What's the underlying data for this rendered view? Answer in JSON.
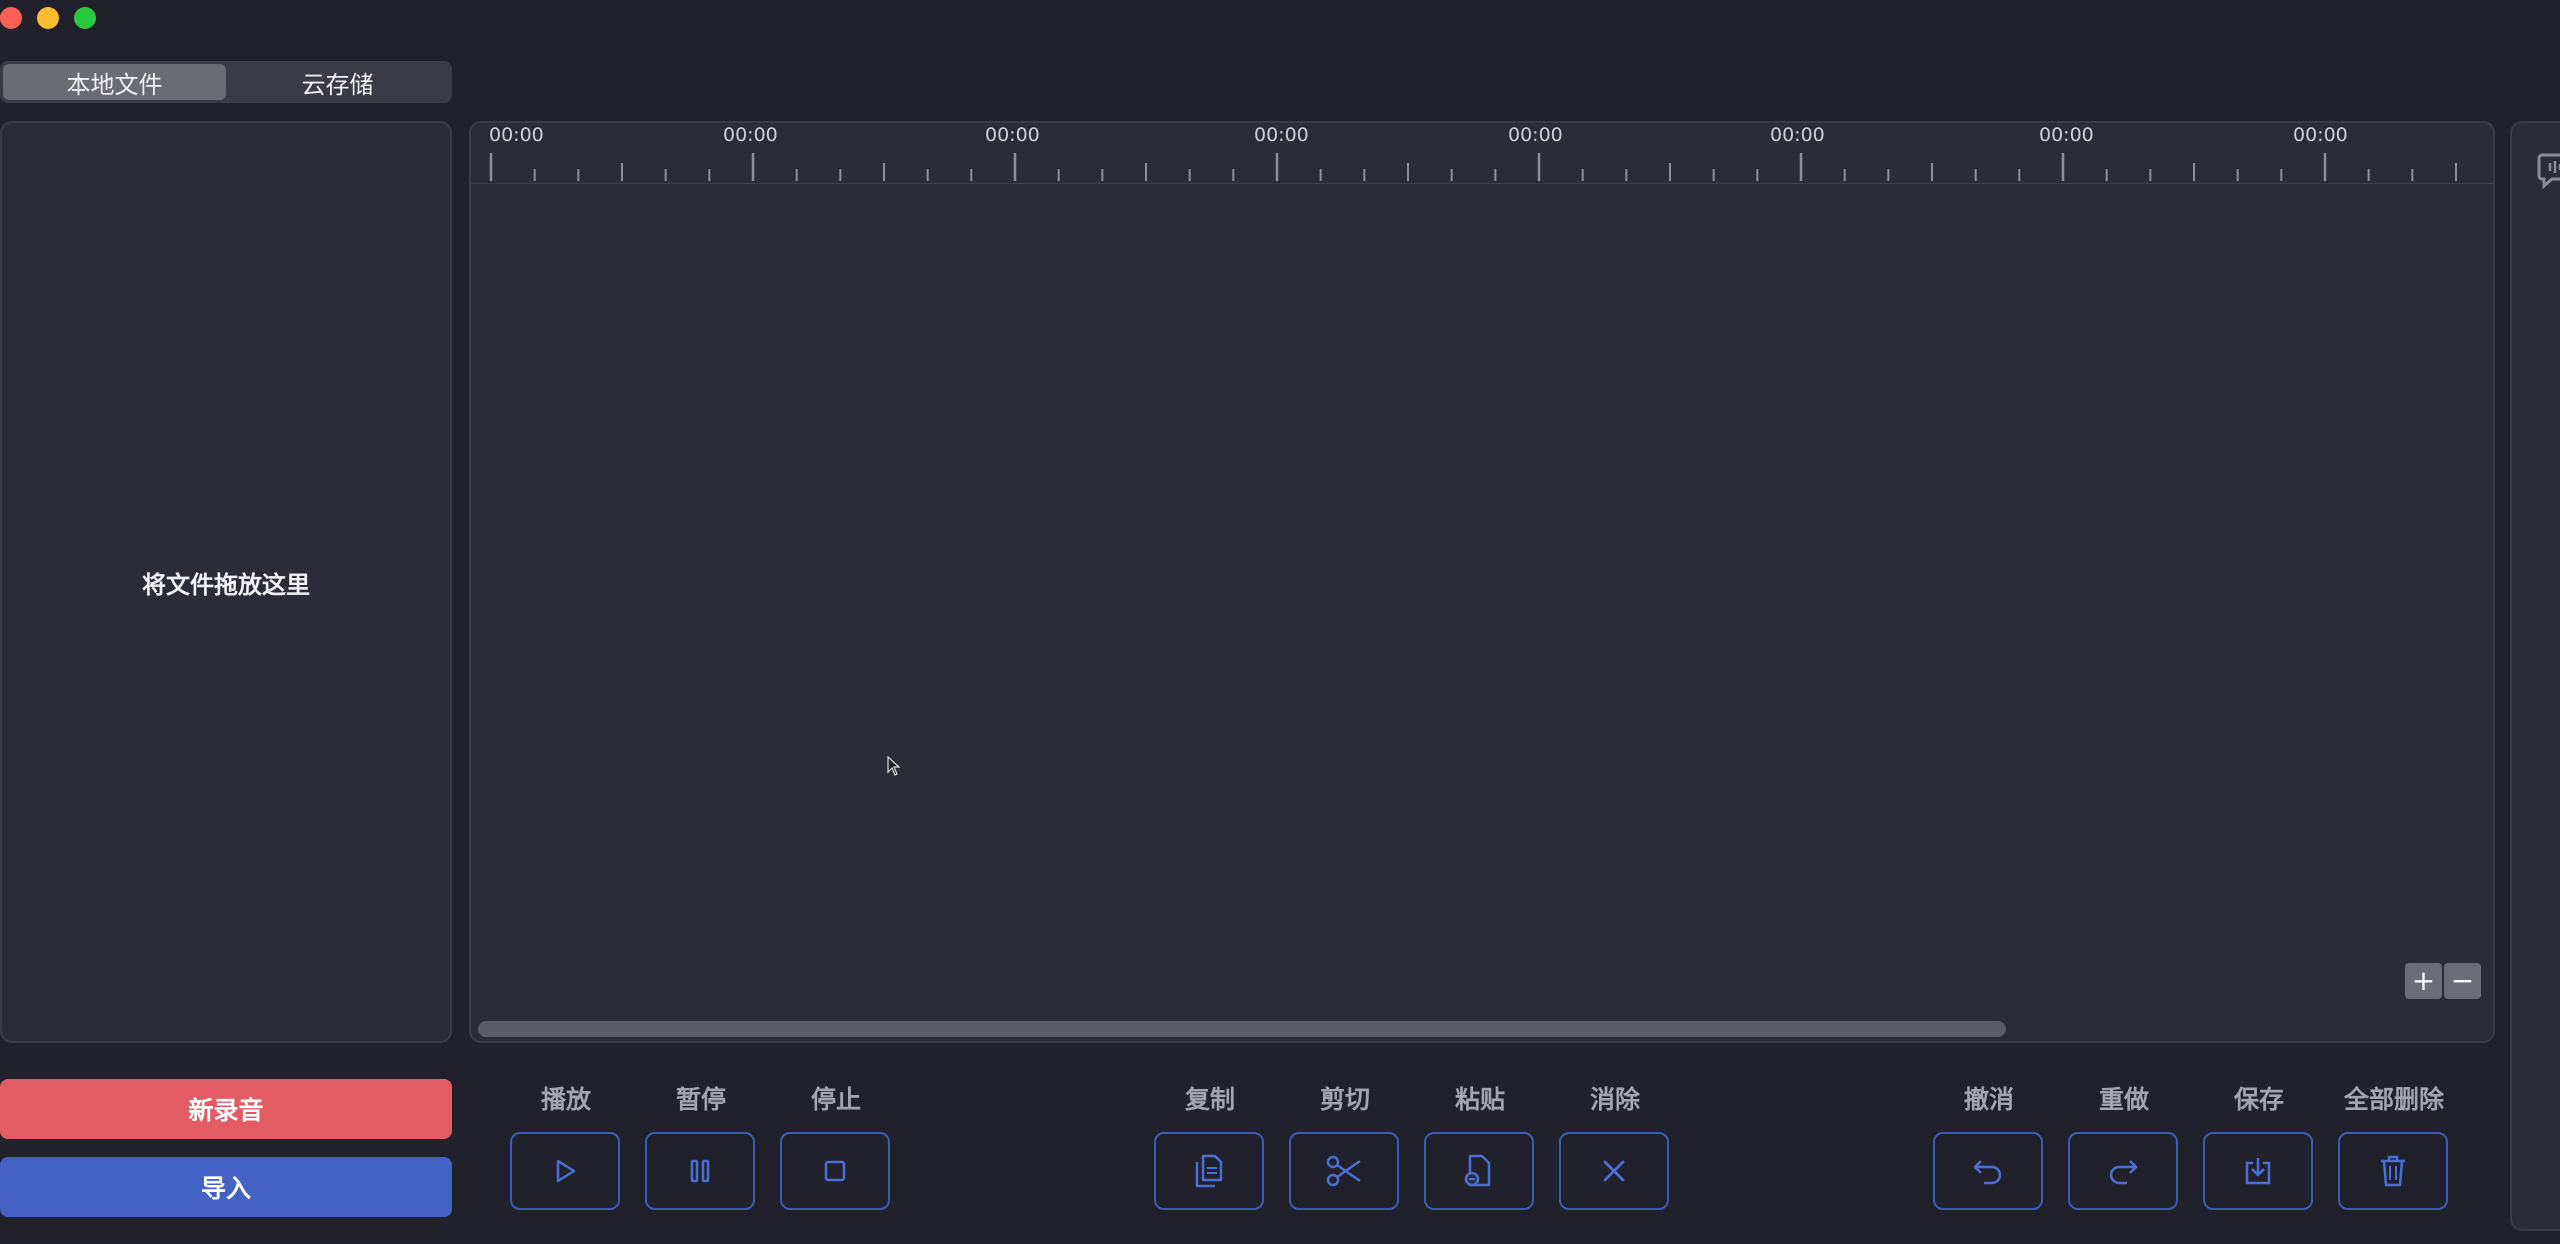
{
  "tabs": [
    {
      "label": "本地文件",
      "active": true
    },
    {
      "label": "云存储",
      "active": false
    }
  ],
  "file_panel": {
    "drop_hint": "将文件拖放这里"
  },
  "actions": {
    "record_label": "新录音",
    "import_label": "导入"
  },
  "timeline": {
    "ruler_labels": [
      "00:00",
      "00:00",
      "00:00",
      "00:00",
      "00:00",
      "00:00",
      "00:00",
      "00:00"
    ],
    "zoom_in": "+",
    "zoom_out": "−"
  },
  "controls": {
    "play": {
      "label": "播放",
      "icon": "play-icon"
    },
    "pause": {
      "label": "暂停",
      "icon": "pause-icon"
    },
    "stop": {
      "label": "停止",
      "icon": "stop-icon"
    },
    "copy": {
      "label": "复制",
      "icon": "copy-icon"
    },
    "cut": {
      "label": "剪切",
      "icon": "scissors-icon"
    },
    "paste": {
      "label": "粘贴",
      "icon": "paste-icon"
    },
    "clear": {
      "label": "消除",
      "icon": "close-icon"
    },
    "undo": {
      "label": "撤消",
      "icon": "undo-icon"
    },
    "redo": {
      "label": "重做",
      "icon": "redo-icon"
    },
    "save": {
      "label": "保存",
      "icon": "download-icon"
    },
    "delete_all": {
      "label": "全部删除",
      "icon": "trash-icon"
    }
  },
  "colors": {
    "accent_outline": "#3e5bb8",
    "record": "#e25c66",
    "import": "#4462c4"
  }
}
